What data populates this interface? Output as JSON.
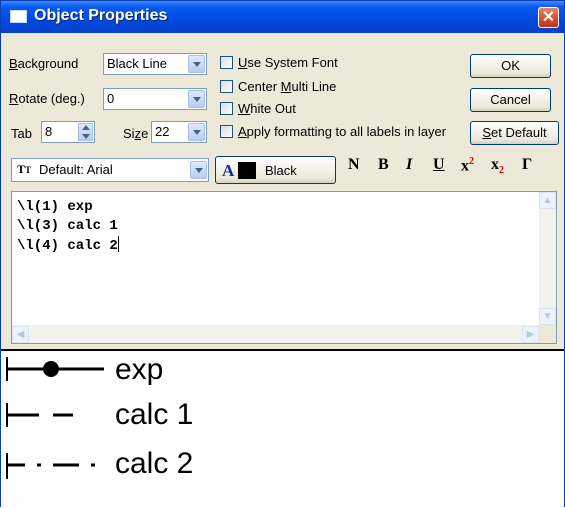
{
  "window": {
    "title": "Object Properties",
    "close_glyph": "✕"
  },
  "controls": {
    "background_label": "Background",
    "background_value": "Black Line",
    "rotate_label": "Rotate (deg.)",
    "rotate_value": "0",
    "tab_label": "Tab",
    "tab_value": "8",
    "size_label": "Size",
    "size_value": "22",
    "font_value": "Default: Arial",
    "color_letter": "A",
    "color_value": "Black",
    "color_swatch": "#000000"
  },
  "checkboxes": [
    {
      "label": "Use System Font",
      "checked": false
    },
    {
      "label": "Center Multi Line",
      "checked": false
    },
    {
      "label": "White Out",
      "checked": false
    },
    {
      "label": "Apply formatting to all labels in layer",
      "checked": false
    }
  ],
  "buttons": {
    "ok": "OK",
    "cancel": "Cancel",
    "set_default": "Set Default"
  },
  "format_buttons": {
    "normal": "N",
    "bold": "B",
    "italic": "I",
    "underline": "U",
    "superscript": "x",
    "superscript_mark": "2",
    "subscript": "x",
    "subscript_mark": "2",
    "greek": "Γ"
  },
  "editor": {
    "lines": [
      "\\l(1) exp",
      "\\l(3) calc 1",
      "\\l(4) calc 2"
    ]
  },
  "preview": {
    "entries": [
      {
        "label": "exp",
        "line_style": "solid-with-dot"
      },
      {
        "label": "calc 1",
        "line_style": "dashed"
      },
      {
        "label": "calc 2",
        "line_style": "dash-dot"
      }
    ]
  }
}
